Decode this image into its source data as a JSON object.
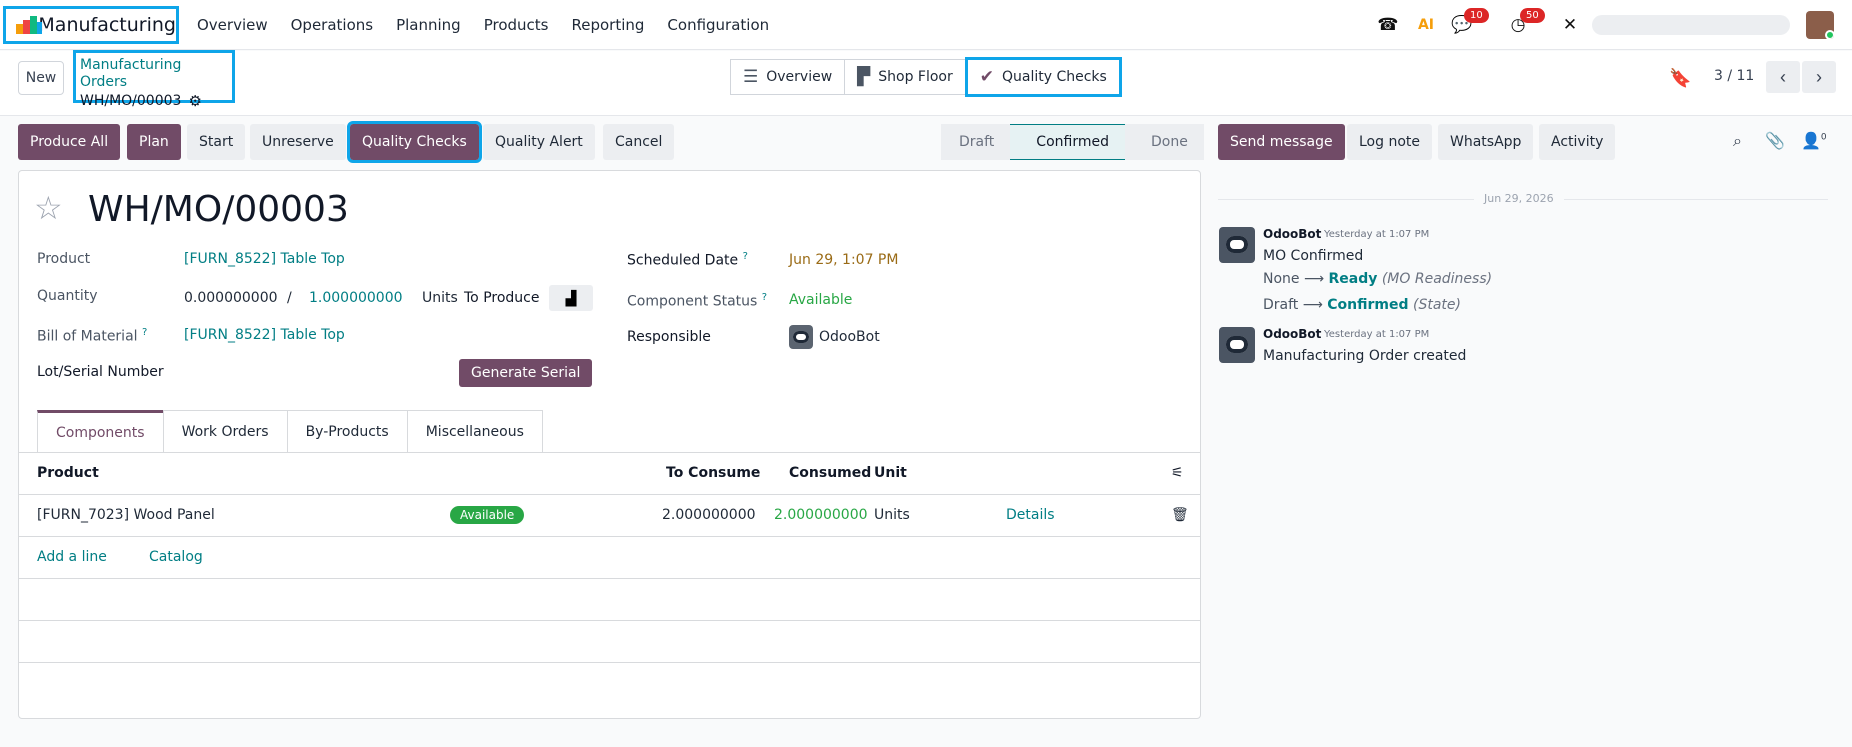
{
  "navbar": {
    "app_name": "Manufacturing",
    "menu": [
      "Overview",
      "Operations",
      "Planning",
      "Products",
      "Reporting",
      "Configuration"
    ],
    "badges": {
      "messages": "10",
      "activities": "50"
    },
    "ai_label": "AI"
  },
  "control": {
    "new_label": "New",
    "breadcrumb_parent": "Manufacturing Orders",
    "breadcrumb_current": "WH/MO/00003",
    "views": {
      "overview": "Overview",
      "shop_floor": "Shop Floor",
      "quality_checks": "Quality Checks"
    },
    "pager": "3 / 11"
  },
  "actions": {
    "produce_all": "Produce All",
    "plan": "Plan",
    "start": "Start",
    "unreserve": "Unreserve",
    "quality_checks": "Quality Checks",
    "quality_alert": "Quality Alert",
    "cancel": "Cancel"
  },
  "statusbar": [
    "Draft",
    "Confirmed",
    "Done"
  ],
  "form": {
    "title": "WH/MO/00003",
    "product_label": "Product",
    "product_value": "[FURN_8522] Table Top",
    "quantity_label": "Quantity",
    "qty_produced": "0.000000000",
    "qty_sep": "/",
    "qty_to_produce": "1.000000000",
    "qty_unit": "Units",
    "to_produce_label": "To Produce",
    "bom_label": "Bill of Material",
    "bom_value": "[FURN_8522] Table Top",
    "lot_label": "Lot/Serial Number",
    "generate_serial": "Generate Serial",
    "scheduled_label": "Scheduled Date",
    "scheduled_value": "Jun 29, 1:07 PM",
    "component_status_label": "Component Status",
    "component_status_value": "Available",
    "responsible_label": "Responsible",
    "responsible_value": "OdooBot",
    "help_mark": "?"
  },
  "tabs": [
    "Components",
    "Work Orders",
    "By-Products",
    "Miscellaneous"
  ],
  "components": {
    "headers": {
      "product": "Product",
      "to_consume": "To Consume",
      "consumed": "Consumed",
      "unit": "Unit"
    },
    "rows": [
      {
        "product": "[FURN_7023] Wood Panel",
        "status": "Available",
        "to_consume": "2.000000000",
        "consumed": "2.000000000",
        "unit": "Units",
        "details": "Details"
      }
    ],
    "add_line": "Add a line",
    "catalog": "Catalog"
  },
  "chatter": {
    "send_message": "Send message",
    "log_note": "Log note",
    "whatsapp": "WhatsApp",
    "activity": "Activity",
    "follower_count": "0",
    "date_separator": "Jun 29, 2026",
    "messages": [
      {
        "author": "OdooBot",
        "time": "Yesterday at 1:07 PM",
        "body": "MO Confirmed",
        "tracking": [
          {
            "old": "None",
            "new": "Ready",
            "field": "(MO Readiness)"
          },
          {
            "old": "Draft",
            "new": "Confirmed",
            "field": "(State)"
          }
        ]
      },
      {
        "author": "OdooBot",
        "time": "Yesterday at 1:07 PM",
        "body": "Manufacturing Order created"
      }
    ]
  },
  "colors": {
    "brand": "#714b67",
    "link": "#017e84",
    "highlight": "#0ea5e9",
    "success": "#28a745"
  }
}
